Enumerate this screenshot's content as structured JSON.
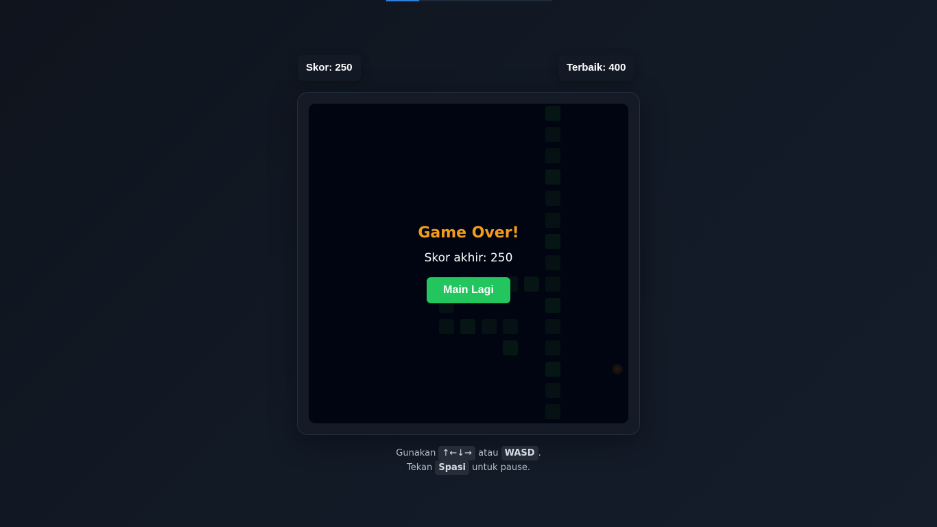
{
  "top_progress": {
    "fraction": 0.2
  },
  "header": {
    "score_text": "Skor: 250",
    "best_text": "Terbaik: 400"
  },
  "game": {
    "snake_color": "#22c55e",
    "food_color": "#f59e0b",
    "overlay": {
      "title": "Game Over!",
      "final_score_text": "Skor akhir: 250",
      "play_again_label": "Main Lagi"
    }
  },
  "instructions": {
    "line1_prefix": "Gunakan",
    "arrow_keys": "↑←↓→",
    "line1_middle": "atau",
    "wasd_key": "WASD",
    "line1_suffix": ".",
    "line2_prefix": "Tekan",
    "space_key": "Spasi",
    "line2_suffix": "untuk pause."
  }
}
